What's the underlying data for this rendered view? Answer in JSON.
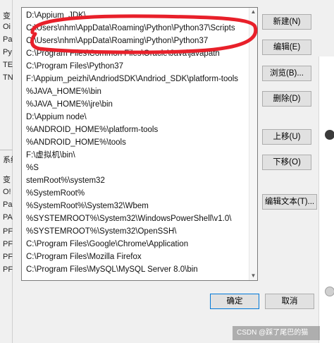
{
  "background_window": {
    "left_lines": [
      "变",
      "Oi",
      "Pa",
      "Py",
      "TE",
      "TN",
      "系统",
      "变",
      "O!",
      "Pa",
      "PA",
      "PF",
      "PF",
      "PF",
      "PF"
    ],
    "right_icons": [
      "avatar-icon",
      "chat-icon"
    ]
  },
  "path_list": [
    "D:\\Appium_JDK\\",
    "C:\\Users\\nhm\\AppData\\Roaming\\Python\\Python37\\Scripts",
    "C:\\Users\\nhm\\AppData\\Roaming\\Python\\Python37",
    "C:\\Program Files\\Common Files\\Oracle\\Java\\javapath",
    "C:\\Program Files\\Python37",
    "F:\\Appium_peizhi\\AndriodSDK\\Andriod_SDK\\platform-tools",
    "%JAVA_HOME%\\bin",
    "%JAVA_HOME%\\jre\\bin",
    "D:\\Appium node\\",
    "%ANDROID_HOME%\\platform-tools",
    "%ANDROID_HOME%\\tools",
    "F:\\虚拟机\\bin\\",
    "%S",
    "stemRoot%\\system32",
    "%SystemRoot%",
    "%SystemRoot%\\System32\\Wbem",
    "%SYSTEMROOT%\\System32\\WindowsPowerShell\\v1.0\\",
    "%SYSTEMROOT%\\System32\\OpenSSH\\",
    "C:\\Program Files\\Google\\Chrome\\Application",
    "C:\\Program Files\\Mozilla Firefox",
    "C:\\Program Files\\MySQL\\MySQL Server 8.0\\bin"
  ],
  "buttons": {
    "new": "新建(N)",
    "edit": "编辑(E)",
    "browse": "浏览(B)...",
    "delete": "删除(D)",
    "move_up": "上移(U)",
    "move_down": "下移(O)",
    "edit_text": "编辑文本(T)...",
    "ok": "确定",
    "cancel": "取消"
  },
  "footer": {
    "watermark": "CSDN @踩了尾巴的猫"
  },
  "colors": {
    "annotation_red": "#e8202a",
    "primary_border": "#0078d7"
  }
}
